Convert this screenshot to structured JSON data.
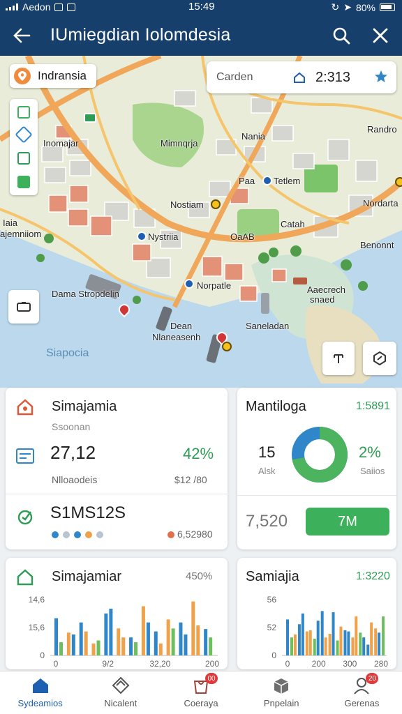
{
  "status_bar": {
    "carrier": "Aedon",
    "time": "15:49",
    "battery": "80%"
  },
  "app_bar": {
    "title": "IUmiegdian Iolomdesia"
  },
  "map": {
    "location_chip": "Indransia",
    "search": {
      "query": "Carden",
      "value": "2:313"
    },
    "labels": {
      "inemajar": "Inomajar",
      "mungria": "Mimnqrja",
      "nania": "Nania",
      "randro": "Randro",
      "paa": "Paa",
      "tetlem": "Tetlem",
      "nostiam": "Nostiam",
      "nordaxlo": "Nordarta",
      "lala": "Iaia",
      "ajemnitom": "ajemniiom",
      "nystrtia": "Nystriia",
      "catah": "Catah",
      "benonnt": "Benonnt",
      "norpatle": "Norpatle",
      "dama": "Dama Stropdelin",
      "saneladen": "Saneladan",
      "dean": "Dean",
      "nanaseach": "Nlaneasenh",
      "siapocia": "Siapocia",
      "aecrech": "Aaecrech",
      "snaed": "snaed",
      "oaab": "OaAB"
    }
  },
  "card1": {
    "title": "Simajamia",
    "subtitle": "Ssoonan",
    "value": "27,12",
    "percent": "42%",
    "row_label": "Nlloaodeis",
    "row_value": "$12 /80",
    "value2": "S1MS12S",
    "foot_value": "6,52980"
  },
  "card2": {
    "title": "Mantiloga",
    "tag": "1:5891",
    "left_value": "15",
    "left_label": "Alsk",
    "right_value": "2%",
    "right_label": "Saiios",
    "bottom_value": "7,520",
    "button": "7M",
    "donut_fraction": 0.72
  },
  "card3": {
    "title": "Simajamiar",
    "tag": "450%",
    "y_ticks": [
      "14,6",
      "15,6",
      "0"
    ],
    "x_ticks": [
      "0",
      "9/2",
      "32,20",
      "200"
    ],
    "series_a": [
      62,
      38,
      55,
      20,
      70,
      45,
      30,
      82,
      40,
      60,
      55,
      90,
      44
    ],
    "series_b": [
      22,
      35,
      40,
      25,
      78,
      30,
      22,
      55,
      20,
      45,
      35,
      50,
      30
    ]
  },
  "card4": {
    "title": "Samiajia",
    "tag": "1:3220",
    "y_ticks": [
      "56",
      "52",
      "0"
    ],
    "x_ticks": [
      "0",
      "200",
      "300",
      "280"
    ],
    "series_a": [
      60,
      35,
      70,
      42,
      58,
      30,
      72,
      48,
      40,
      65,
      30,
      55,
      38
    ],
    "series_b": [
      30,
      52,
      40,
      28,
      74,
      36,
      25,
      42,
      30,
      38,
      18,
      45,
      65
    ]
  },
  "bottom_nav": [
    {
      "label": "Sydeamios",
      "badge": ""
    },
    {
      "label": "Nicalent",
      "badge": ""
    },
    {
      "label": "Coeraya",
      "badge": "00"
    },
    {
      "label": "Pnpelain",
      "badge": ""
    },
    {
      "label": "Gerenas",
      "badge": "20"
    }
  ],
  "colors": {
    "header": "#173f6b",
    "accent": "#1d5fb0",
    "positive": "#2e9c54",
    "bar_blue": "#2f86c8",
    "bar_orange": "#f0a24a",
    "bar_green": "#6cbf5c"
  }
}
